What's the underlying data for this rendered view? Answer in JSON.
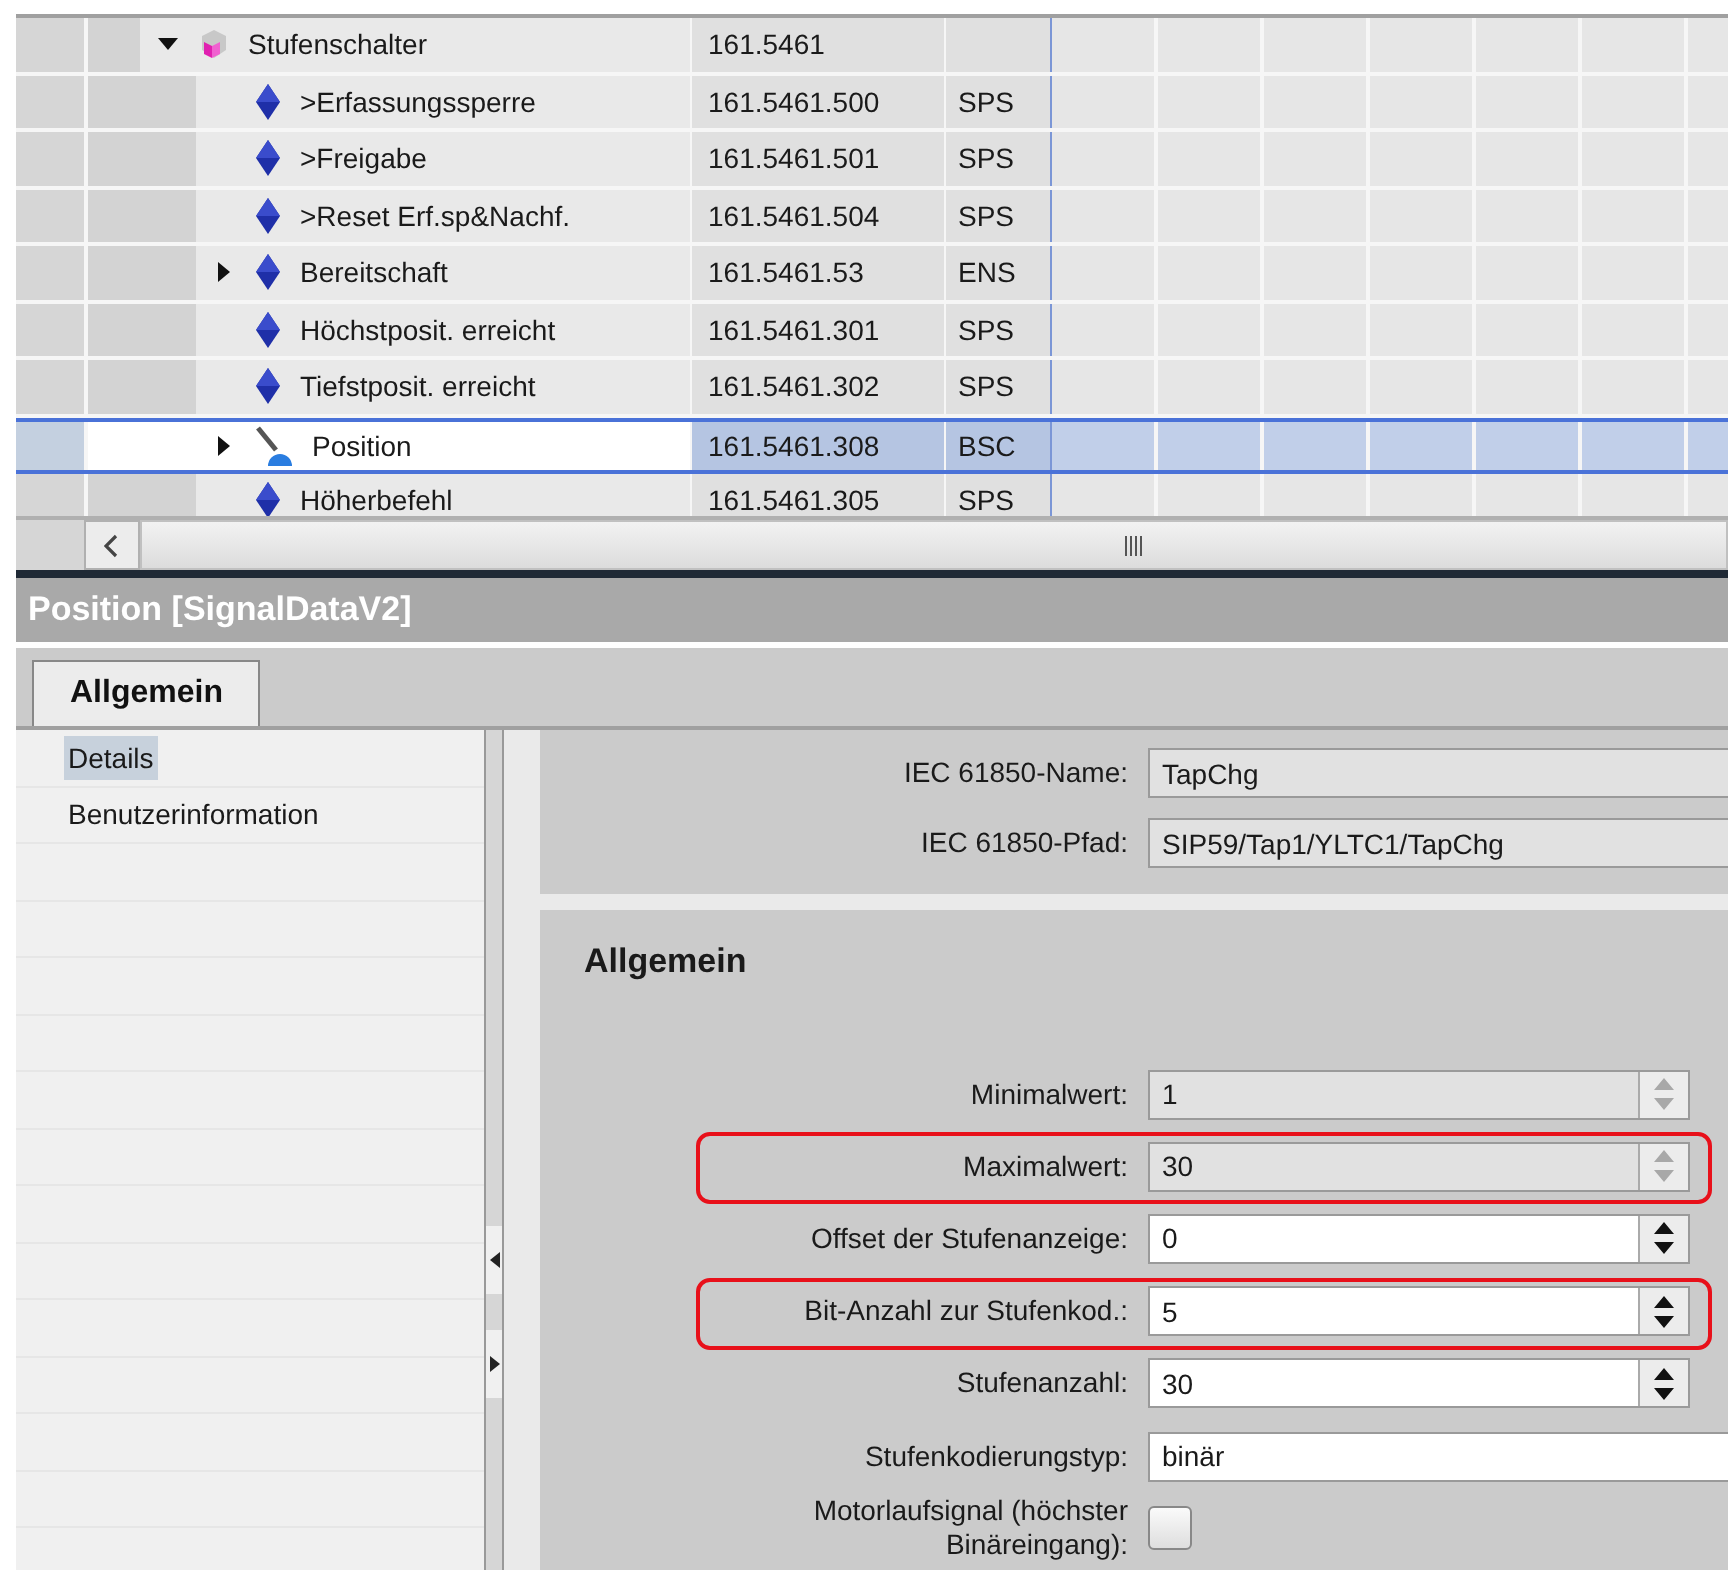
{
  "tree": {
    "rows": [
      {
        "label": "Stufenschalter",
        "id": "161.5461",
        "kind": "group",
        "expanded": true,
        "selected": false,
        "children": [
          {
            "label": ">Erfassungssperre",
            "id": "161.5461.500",
            "type": "SPS",
            "kind": "signal",
            "selected": false
          },
          {
            "label": ">Freigabe",
            "id": "161.5461.501",
            "type": "SPS",
            "kind": "signal",
            "selected": false
          },
          {
            "label": ">Reset Erf.sp&Nachf.",
            "id": "161.5461.504",
            "type": "SPS",
            "kind": "signal",
            "selected": false
          },
          {
            "label": "Bereitschaft",
            "id": "161.5461.53",
            "type": "ENS",
            "kind": "signal",
            "expanded": false,
            "selected": false
          },
          {
            "label": "Höchstposit. erreicht",
            "id": "161.5461.301",
            "type": "SPS",
            "kind": "signal",
            "selected": false
          },
          {
            "label": "Tiefstposit. erreicht",
            "id": "161.5461.302",
            "type": "SPS",
            "kind": "signal",
            "selected": false
          },
          {
            "label": "Position",
            "id": "161.5461.308",
            "type": "BSC",
            "kind": "tapchanger",
            "expanded": false,
            "selected": true
          },
          {
            "label": "Höherbefehl",
            "id": "161.5461.305",
            "type": "SPS",
            "kind": "signal",
            "selected": false
          }
        ]
      }
    ]
  },
  "inspector": {
    "title": "Position [SignalDataV2]",
    "tabs": [
      {
        "label": "Allgemein",
        "selected": true
      }
    ],
    "nav": [
      {
        "label": "Details",
        "selected": true
      },
      {
        "label": "Benutzerinformation",
        "selected": false
      }
    ],
    "identity": [
      {
        "label": "IEC 61850-Name:",
        "kind": "text",
        "value": "TapChg",
        "disabled": true
      },
      {
        "label": "IEC 61850-Pfad:",
        "kind": "text",
        "value": "SIP59/Tap1/YLTC1/TapChg",
        "disabled": true
      }
    ],
    "section": {
      "heading": "Allgemein",
      "fields": [
        {
          "label": "Minimalwert:",
          "kind": "spin",
          "value": "1",
          "disabled": true,
          "highlighted": false
        },
        {
          "label": "Maximalwert:",
          "kind": "spin",
          "value": "30",
          "disabled": true,
          "highlighted": true
        },
        {
          "label": "Offset der Stufenanzeige:",
          "kind": "spin",
          "value": "0",
          "disabled": false,
          "highlighted": false
        },
        {
          "label": "Bit-Anzahl zur Stufenkod.:",
          "kind": "spin",
          "value": "5",
          "disabled": false,
          "highlighted": true
        },
        {
          "label": "Stufenanzahl:",
          "kind": "spin",
          "value": "30",
          "disabled": false,
          "highlighted": false
        },
        {
          "label": "Stufenkodierungstyp:",
          "kind": "text",
          "value": "binär",
          "disabled": false,
          "highlighted": false
        },
        {
          "label": "Motorlaufsignal (höchster Binäreingang):",
          "kind": "checkbox",
          "checked": false,
          "disabled": false,
          "highlighted": false
        }
      ]
    }
  }
}
